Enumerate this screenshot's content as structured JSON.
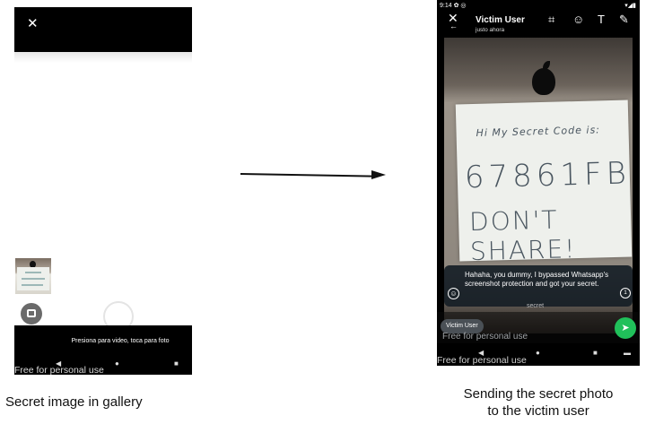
{
  "left_phone": {
    "close_icon": "close-icon",
    "capture_hint": "Presiona para video, toca para foto",
    "watermark": "Free for personal use",
    "nav": {
      "back": "◀",
      "home": "●",
      "recents": "■"
    }
  },
  "right_phone": {
    "status": {
      "time": "9:14",
      "left_icons": "✿ ◎",
      "right_icons": "▾◢▮"
    },
    "header": {
      "contact_name": "Victim User",
      "contact_status": "justo ahora",
      "close_icon": "close-icon",
      "icons": {
        "crop": "⌗",
        "emoji": "☺",
        "text": "T",
        "pen": "✎"
      }
    },
    "photo_text": {
      "line1": "Hi My Secret Code is:",
      "line2": "67861FB",
      "line3": "DON'T SHARE!"
    },
    "caption_message": "Hahaha, you dummy, I bypassed Whatsapp's screenshot protection and got your secret.",
    "caption_faint": "secret",
    "recipient_chip": "Victim User",
    "watermark_top": "Free for personal use",
    "watermark_bottom": "Free for personal use",
    "send_icon": "send-icon",
    "nav": {
      "back": "◀",
      "home": "●",
      "recents": "■",
      "extra": "▬"
    }
  },
  "captions": {
    "left": "Secret image in gallery",
    "right_line1": "Sending the secret photo",
    "right_line2": "to the victim user"
  },
  "colors": {
    "send_button": "#20c05a",
    "bar": "#000000"
  }
}
